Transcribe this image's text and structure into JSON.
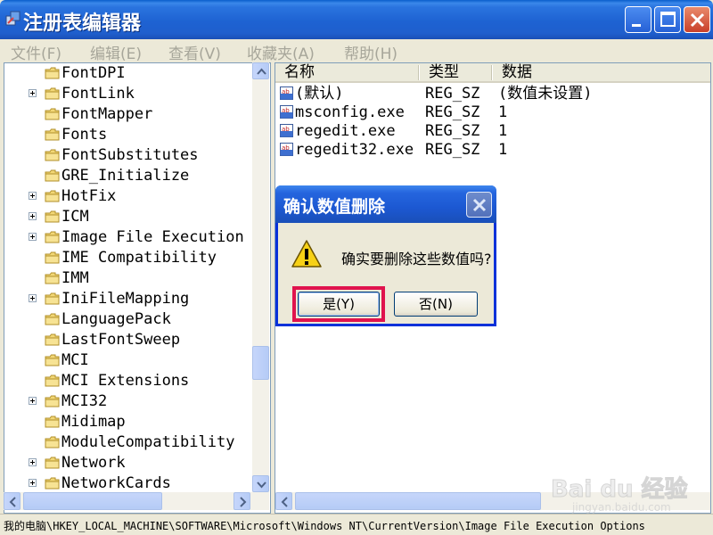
{
  "window": {
    "title": "注册表编辑器"
  },
  "menu": {
    "items": [
      "文件(F)",
      "编辑(E)",
      "查看(V)",
      "收藏夹(A)",
      "帮助(H)"
    ]
  },
  "tree": {
    "items": [
      {
        "label": "FontDPI",
        "expandable": false
      },
      {
        "label": "FontLink",
        "expandable": true
      },
      {
        "label": "FontMapper",
        "expandable": false
      },
      {
        "label": "Fonts",
        "expandable": false
      },
      {
        "label": "FontSubstitutes",
        "expandable": false
      },
      {
        "label": "GRE_Initialize",
        "expandable": false
      },
      {
        "label": "HotFix",
        "expandable": true
      },
      {
        "label": "ICM",
        "expandable": true
      },
      {
        "label": "Image File Execution (",
        "expandable": true
      },
      {
        "label": "IME Compatibility",
        "expandable": false
      },
      {
        "label": "IMM",
        "expandable": false
      },
      {
        "label": "IniFileMapping",
        "expandable": true
      },
      {
        "label": "LanguagePack",
        "expandable": false
      },
      {
        "label": "LastFontSweep",
        "expandable": false
      },
      {
        "label": "MCI",
        "expandable": false
      },
      {
        "label": "MCI Extensions",
        "expandable": false
      },
      {
        "label": "MCI32",
        "expandable": true
      },
      {
        "label": "Midimap",
        "expandable": false
      },
      {
        "label": "ModuleCompatibility",
        "expandable": false
      },
      {
        "label": "Network",
        "expandable": true
      },
      {
        "label": "NetworkCards",
        "expandable": true
      }
    ]
  },
  "list": {
    "columns": [
      "名称",
      "类型",
      "数据"
    ],
    "rows": [
      {
        "name": "(默认)",
        "type": "REG_SZ",
        "data": "(数值未设置)"
      },
      {
        "name": "msconfig.exe",
        "type": "REG_SZ",
        "data": "1"
      },
      {
        "name": "regedit.exe",
        "type": "REG_SZ",
        "data": "1"
      },
      {
        "name": "regedit32.exe",
        "type": "REG_SZ",
        "data": "1"
      }
    ]
  },
  "status": {
    "path": "我的电脑\\HKEY_LOCAL_MACHINE\\SOFTWARE\\Microsoft\\Windows NT\\CurrentVersion\\Image File Execution Options"
  },
  "dialog": {
    "title": "确认数值删除",
    "message": "确实要删除这些数值吗?",
    "yes_label": "是(Y)",
    "no_label": "否(N)",
    "icon": "warning-icon"
  },
  "watermark": {
    "brand": "Bai du 经验",
    "sub": "jingyan.baidu.com"
  },
  "colors": {
    "titlebar": "#1e62d2",
    "highlight": "#e0134d",
    "menu_text": "#a7a69a"
  }
}
